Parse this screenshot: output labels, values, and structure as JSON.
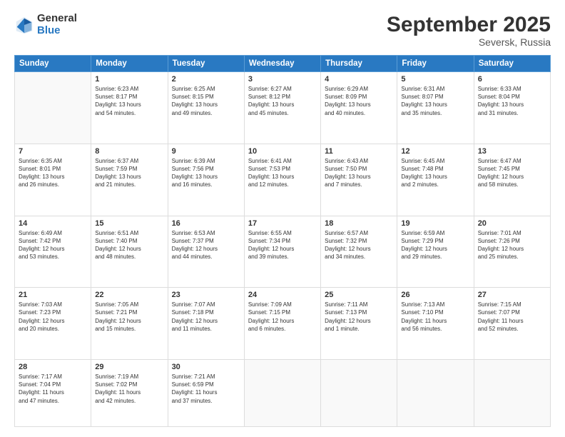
{
  "logo": {
    "general": "General",
    "blue": "Blue"
  },
  "title": "September 2025",
  "location": "Seversk, Russia",
  "days_header": [
    "Sunday",
    "Monday",
    "Tuesday",
    "Wednesday",
    "Thursday",
    "Friday",
    "Saturday"
  ],
  "weeks": [
    [
      {
        "day": "",
        "info": ""
      },
      {
        "day": "1",
        "info": "Sunrise: 6:23 AM\nSunset: 8:17 PM\nDaylight: 13 hours\nand 54 minutes."
      },
      {
        "day": "2",
        "info": "Sunrise: 6:25 AM\nSunset: 8:15 PM\nDaylight: 13 hours\nand 49 minutes."
      },
      {
        "day": "3",
        "info": "Sunrise: 6:27 AM\nSunset: 8:12 PM\nDaylight: 13 hours\nand 45 minutes."
      },
      {
        "day": "4",
        "info": "Sunrise: 6:29 AM\nSunset: 8:09 PM\nDaylight: 13 hours\nand 40 minutes."
      },
      {
        "day": "5",
        "info": "Sunrise: 6:31 AM\nSunset: 8:07 PM\nDaylight: 13 hours\nand 35 minutes."
      },
      {
        "day": "6",
        "info": "Sunrise: 6:33 AM\nSunset: 8:04 PM\nDaylight: 13 hours\nand 31 minutes."
      }
    ],
    [
      {
        "day": "7",
        "info": "Sunrise: 6:35 AM\nSunset: 8:01 PM\nDaylight: 13 hours\nand 26 minutes."
      },
      {
        "day": "8",
        "info": "Sunrise: 6:37 AM\nSunset: 7:59 PM\nDaylight: 13 hours\nand 21 minutes."
      },
      {
        "day": "9",
        "info": "Sunrise: 6:39 AM\nSunset: 7:56 PM\nDaylight: 13 hours\nand 16 minutes."
      },
      {
        "day": "10",
        "info": "Sunrise: 6:41 AM\nSunset: 7:53 PM\nDaylight: 13 hours\nand 12 minutes."
      },
      {
        "day": "11",
        "info": "Sunrise: 6:43 AM\nSunset: 7:50 PM\nDaylight: 13 hours\nand 7 minutes."
      },
      {
        "day": "12",
        "info": "Sunrise: 6:45 AM\nSunset: 7:48 PM\nDaylight: 13 hours\nand 2 minutes."
      },
      {
        "day": "13",
        "info": "Sunrise: 6:47 AM\nSunset: 7:45 PM\nDaylight: 12 hours\nand 58 minutes."
      }
    ],
    [
      {
        "day": "14",
        "info": "Sunrise: 6:49 AM\nSunset: 7:42 PM\nDaylight: 12 hours\nand 53 minutes."
      },
      {
        "day": "15",
        "info": "Sunrise: 6:51 AM\nSunset: 7:40 PM\nDaylight: 12 hours\nand 48 minutes."
      },
      {
        "day": "16",
        "info": "Sunrise: 6:53 AM\nSunset: 7:37 PM\nDaylight: 12 hours\nand 44 minutes."
      },
      {
        "day": "17",
        "info": "Sunrise: 6:55 AM\nSunset: 7:34 PM\nDaylight: 12 hours\nand 39 minutes."
      },
      {
        "day": "18",
        "info": "Sunrise: 6:57 AM\nSunset: 7:32 PM\nDaylight: 12 hours\nand 34 minutes."
      },
      {
        "day": "19",
        "info": "Sunrise: 6:59 AM\nSunset: 7:29 PM\nDaylight: 12 hours\nand 29 minutes."
      },
      {
        "day": "20",
        "info": "Sunrise: 7:01 AM\nSunset: 7:26 PM\nDaylight: 12 hours\nand 25 minutes."
      }
    ],
    [
      {
        "day": "21",
        "info": "Sunrise: 7:03 AM\nSunset: 7:23 PM\nDaylight: 12 hours\nand 20 minutes."
      },
      {
        "day": "22",
        "info": "Sunrise: 7:05 AM\nSunset: 7:21 PM\nDaylight: 12 hours\nand 15 minutes."
      },
      {
        "day": "23",
        "info": "Sunrise: 7:07 AM\nSunset: 7:18 PM\nDaylight: 12 hours\nand 11 minutes."
      },
      {
        "day": "24",
        "info": "Sunrise: 7:09 AM\nSunset: 7:15 PM\nDaylight: 12 hours\nand 6 minutes."
      },
      {
        "day": "25",
        "info": "Sunrise: 7:11 AM\nSunset: 7:13 PM\nDaylight: 12 hours\nand 1 minute."
      },
      {
        "day": "26",
        "info": "Sunrise: 7:13 AM\nSunset: 7:10 PM\nDaylight: 11 hours\nand 56 minutes."
      },
      {
        "day": "27",
        "info": "Sunrise: 7:15 AM\nSunset: 7:07 PM\nDaylight: 11 hours\nand 52 minutes."
      }
    ],
    [
      {
        "day": "28",
        "info": "Sunrise: 7:17 AM\nSunset: 7:04 PM\nDaylight: 11 hours\nand 47 minutes."
      },
      {
        "day": "29",
        "info": "Sunrise: 7:19 AM\nSunset: 7:02 PM\nDaylight: 11 hours\nand 42 minutes."
      },
      {
        "day": "30",
        "info": "Sunrise: 7:21 AM\nSunset: 6:59 PM\nDaylight: 11 hours\nand 37 minutes."
      },
      {
        "day": "",
        "info": ""
      },
      {
        "day": "",
        "info": ""
      },
      {
        "day": "",
        "info": ""
      },
      {
        "day": "",
        "info": ""
      }
    ]
  ]
}
